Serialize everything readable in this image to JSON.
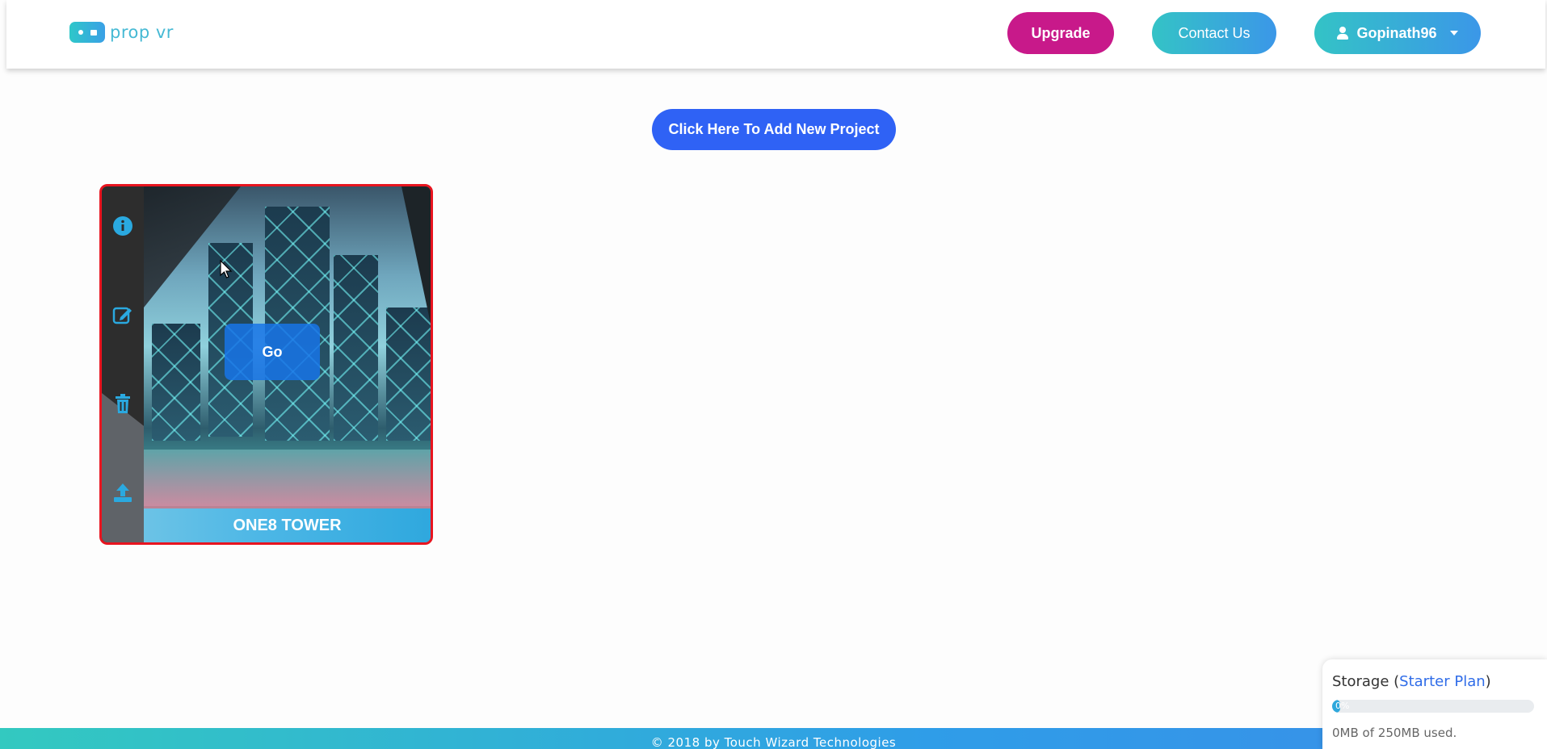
{
  "header": {
    "logo_text": "prop vr",
    "upgrade_label": "Upgrade",
    "contact_label": "Contact Us",
    "user_label": "Gopinath96"
  },
  "main": {
    "add_project_label": "Click Here To Add New Project"
  },
  "projects": [
    {
      "title": "ONE8 TOWER",
      "go_label": "Go",
      "actions": [
        "info-icon",
        "edit-icon",
        "trash-icon",
        "upload-icon"
      ]
    }
  ],
  "storage": {
    "title_prefix": "Storage (",
    "plan": "Starter Plan",
    "title_suffix": ")",
    "bar_label": "0%",
    "used_fraction": 0.04,
    "used_text": "0MB of 250MB used."
  },
  "footer": {
    "copyright": "© 2018 by Touch Wizard Technologies"
  },
  "colors": {
    "upgrade": "#c8198a",
    "gradient_start": "#34c3c6",
    "gradient_end": "#3b97e8",
    "add_project": "#2f62f5",
    "card_border": "#e8141f"
  }
}
